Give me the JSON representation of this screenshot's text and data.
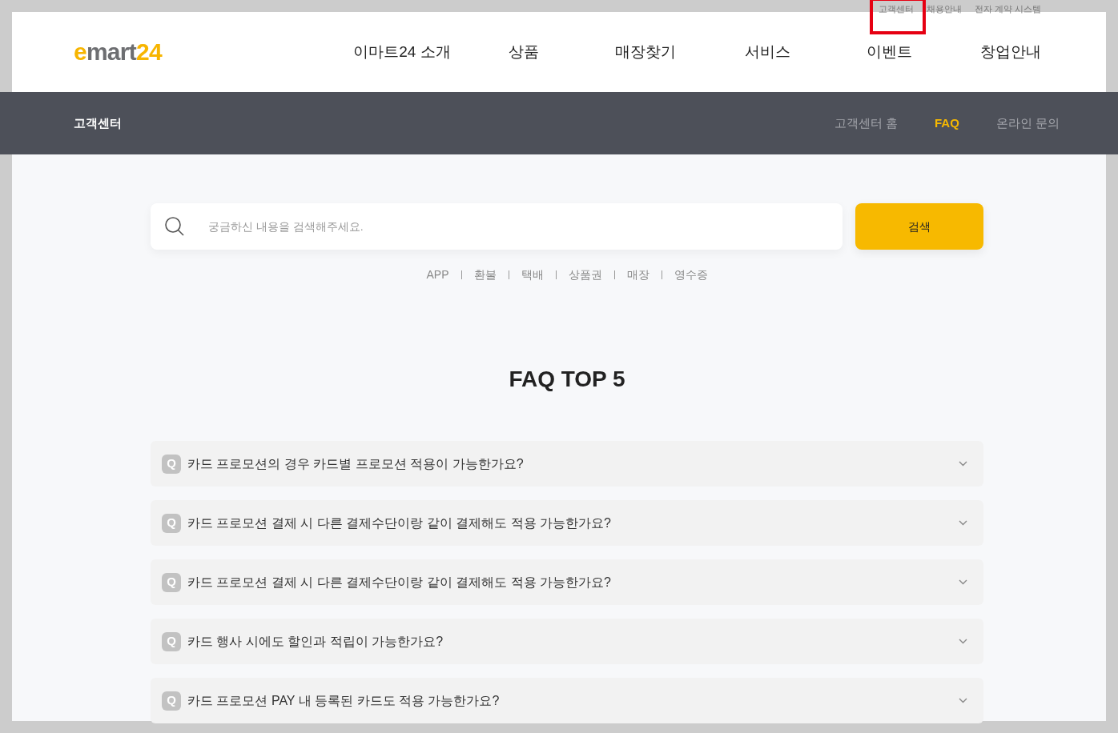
{
  "utility_links": [
    {
      "label": "고객센터",
      "highlighted": true
    },
    {
      "label": "채용안내",
      "highlighted": false
    },
    {
      "label": "전자 계약 시스템",
      "highlighted": false
    }
  ],
  "header": {
    "logo": {
      "prefix": "e",
      "middle": "mart",
      "suffix": "24"
    },
    "nav": [
      "이마트24 소개",
      "상품",
      "매장찾기",
      "서비스",
      "이벤트",
      "창업안내"
    ]
  },
  "subnav": {
    "title": "고객센터",
    "tabs": [
      {
        "label": "고객센터 홈",
        "selected": false
      },
      {
        "label": "FAQ",
        "selected": true
      },
      {
        "label": "온라인 문의",
        "selected": false
      }
    ]
  },
  "search": {
    "placeholder": "궁금하신 내용을 검색해주세요.",
    "button": "검색"
  },
  "keywords": [
    "APP",
    "환불",
    "택배",
    "상품권",
    "매장",
    "영수증"
  ],
  "faq_title": "FAQ TOP 5",
  "faq": [
    {
      "badge": "Q",
      "question": "카드 프로모션의 경우 카드별 프로모션 적용이 가능한가요?",
      "expanded": false
    },
    {
      "badge": "Q",
      "question": "카드 프로모션 결제 시 다른 결제수단이랑 같이 결제해도 적용 가능한가요?",
      "expanded": false
    },
    {
      "badge": "Q",
      "question": "카드 프로모션 결제 시 다른 결제수단이랑 같이 결제해도 적용 가능한가요?",
      "expanded": false
    },
    {
      "badge": "Q",
      "question": "카드 행사 시에도 할인과 적립이 가능한가요?",
      "expanded": false
    },
    {
      "badge": "Q",
      "question": "카드 프로모션 PAY 내 등록된 카드도 적용 가능한가요?",
      "expanded": false
    }
  ]
}
